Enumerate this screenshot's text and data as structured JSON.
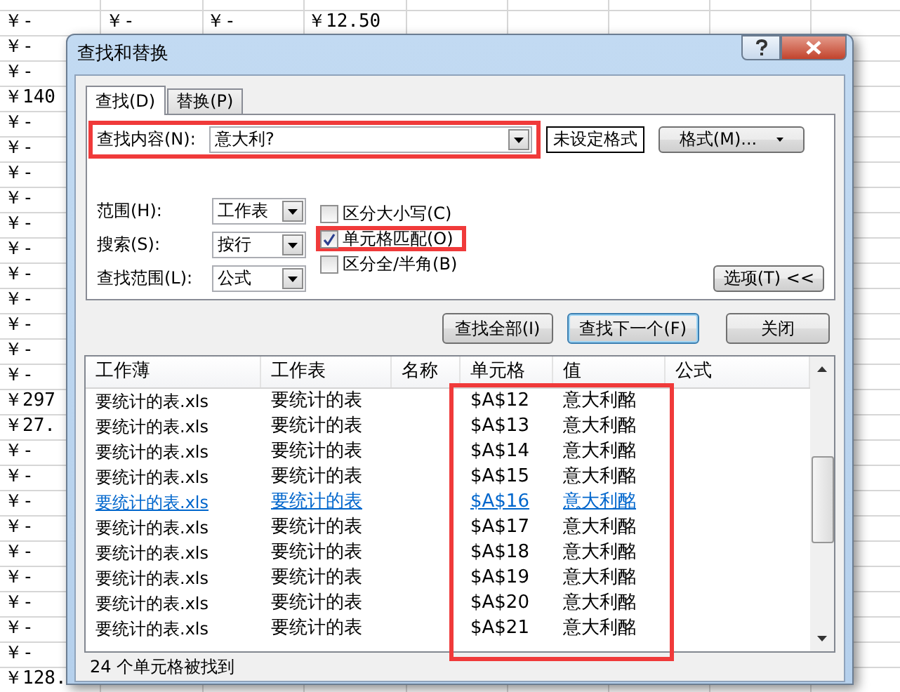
{
  "spreadsheet": {
    "rows": [
      {
        "cells": [
          "￥-",
          "￥-",
          "￥-",
          "￥12.50"
        ]
      },
      {
        "cells": [
          "￥-"
        ]
      },
      {
        "cells": [
          "￥-"
        ]
      },
      {
        "cells": [
          "￥140"
        ]
      },
      {
        "cells": [
          "￥-"
        ]
      },
      {
        "cells": [
          "￥-"
        ]
      },
      {
        "cells": [
          "￥-"
        ]
      },
      {
        "cells": [
          "￥-"
        ]
      },
      {
        "cells": [
          "￥-"
        ]
      },
      {
        "cells": [
          "￥-"
        ]
      },
      {
        "cells": [
          "￥-"
        ]
      },
      {
        "cells": [
          "￥-"
        ]
      },
      {
        "cells": [
          "￥-"
        ]
      },
      {
        "cells": [
          "￥-"
        ]
      },
      {
        "cells": [
          "￥-"
        ]
      },
      {
        "cells": [
          "￥297"
        ]
      },
      {
        "cells": [
          "￥27."
        ]
      },
      {
        "cells": [
          "￥-"
        ]
      },
      {
        "cells": [
          "￥-"
        ]
      },
      {
        "cells": [
          "￥-"
        ]
      },
      {
        "cells": [
          "￥-"
        ]
      },
      {
        "cells": [
          "￥-"
        ]
      },
      {
        "cells": [
          "￥-"
        ]
      },
      {
        "cells": [
          "￥-"
        ]
      },
      {
        "cells": [
          "￥-"
        ]
      },
      {
        "cells": [
          "￥-"
        ]
      },
      {
        "cells": [
          "￥128."
        ]
      }
    ]
  },
  "dialog": {
    "title": "查找和替换",
    "tabs": [
      {
        "label": "查找(D)",
        "selected": true
      },
      {
        "label": "替换(P)",
        "selected": false
      }
    ],
    "find_what": {
      "label": "查找内容(N):",
      "value": "意大利?",
      "highlighted": true
    },
    "format_preview": "未设定格式",
    "format_button": "格式(M)...",
    "options": [
      {
        "label": "范围(H):",
        "value": "工作表"
      },
      {
        "label": "搜索(S):",
        "value": "按行"
      },
      {
        "label": "查找范围(L):",
        "value": "公式"
      }
    ],
    "checkboxes": [
      {
        "label": "区分大小写(C)",
        "checked": false,
        "highlighted": false
      },
      {
        "label": "单元格匹配(O)",
        "checked": true,
        "highlighted": true
      },
      {
        "label": "区分全/半角(B)",
        "checked": false,
        "highlighted": false
      }
    ],
    "options_button": "选项(T) <<",
    "buttons": [
      {
        "label": "查找全部(I)",
        "focused": false
      },
      {
        "label": "查找下一个(F)",
        "focused": true
      },
      {
        "label": "关闭",
        "focused": false
      }
    ],
    "results": {
      "highlighted": true,
      "columns": [
        "工作薄",
        "工作表",
        "名称",
        "单元格",
        "值",
        "公式"
      ],
      "rows": [
        {
          "workbook": "要统计的表.xls",
          "worksheet": "要统计的表",
          "cell": "$A$12",
          "value": "意大利酩",
          "selected": false
        },
        {
          "workbook": "要统计的表.xls",
          "worksheet": "要统计的表",
          "cell": "$A$13",
          "value": "意大利酩",
          "selected": false
        },
        {
          "workbook": "要统计的表.xls",
          "worksheet": "要统计的表",
          "cell": "$A$14",
          "value": "意大利酩",
          "selected": false
        },
        {
          "workbook": "要统计的表.xls",
          "worksheet": "要统计的表",
          "cell": "$A$15",
          "value": "意大利酩",
          "selected": false
        },
        {
          "workbook": "要统计的表.xls",
          "worksheet": "要统计的表",
          "cell": "$A$16",
          "value": "意大利酩",
          "selected": true
        },
        {
          "workbook": "要统计的表.xls",
          "worksheet": "要统计的表",
          "cell": "$A$17",
          "value": "意大利酩",
          "selected": false
        },
        {
          "workbook": "要统计的表.xls",
          "worksheet": "要统计的表",
          "cell": "$A$18",
          "value": "意大利酩",
          "selected": false
        },
        {
          "workbook": "要统计的表.xls",
          "worksheet": "要统计的表",
          "cell": "$A$19",
          "value": "意大利酩",
          "selected": false
        },
        {
          "workbook": "要统计的表.xls",
          "worksheet": "要统计的表",
          "cell": "$A$20",
          "value": "意大利酩",
          "selected": false
        },
        {
          "workbook": "要统计的表.xls",
          "worksheet": "要统计的表",
          "cell": "$A$21",
          "value": "意大利酩",
          "selected": false
        }
      ]
    },
    "status": "24 个单元格被找到"
  }
}
